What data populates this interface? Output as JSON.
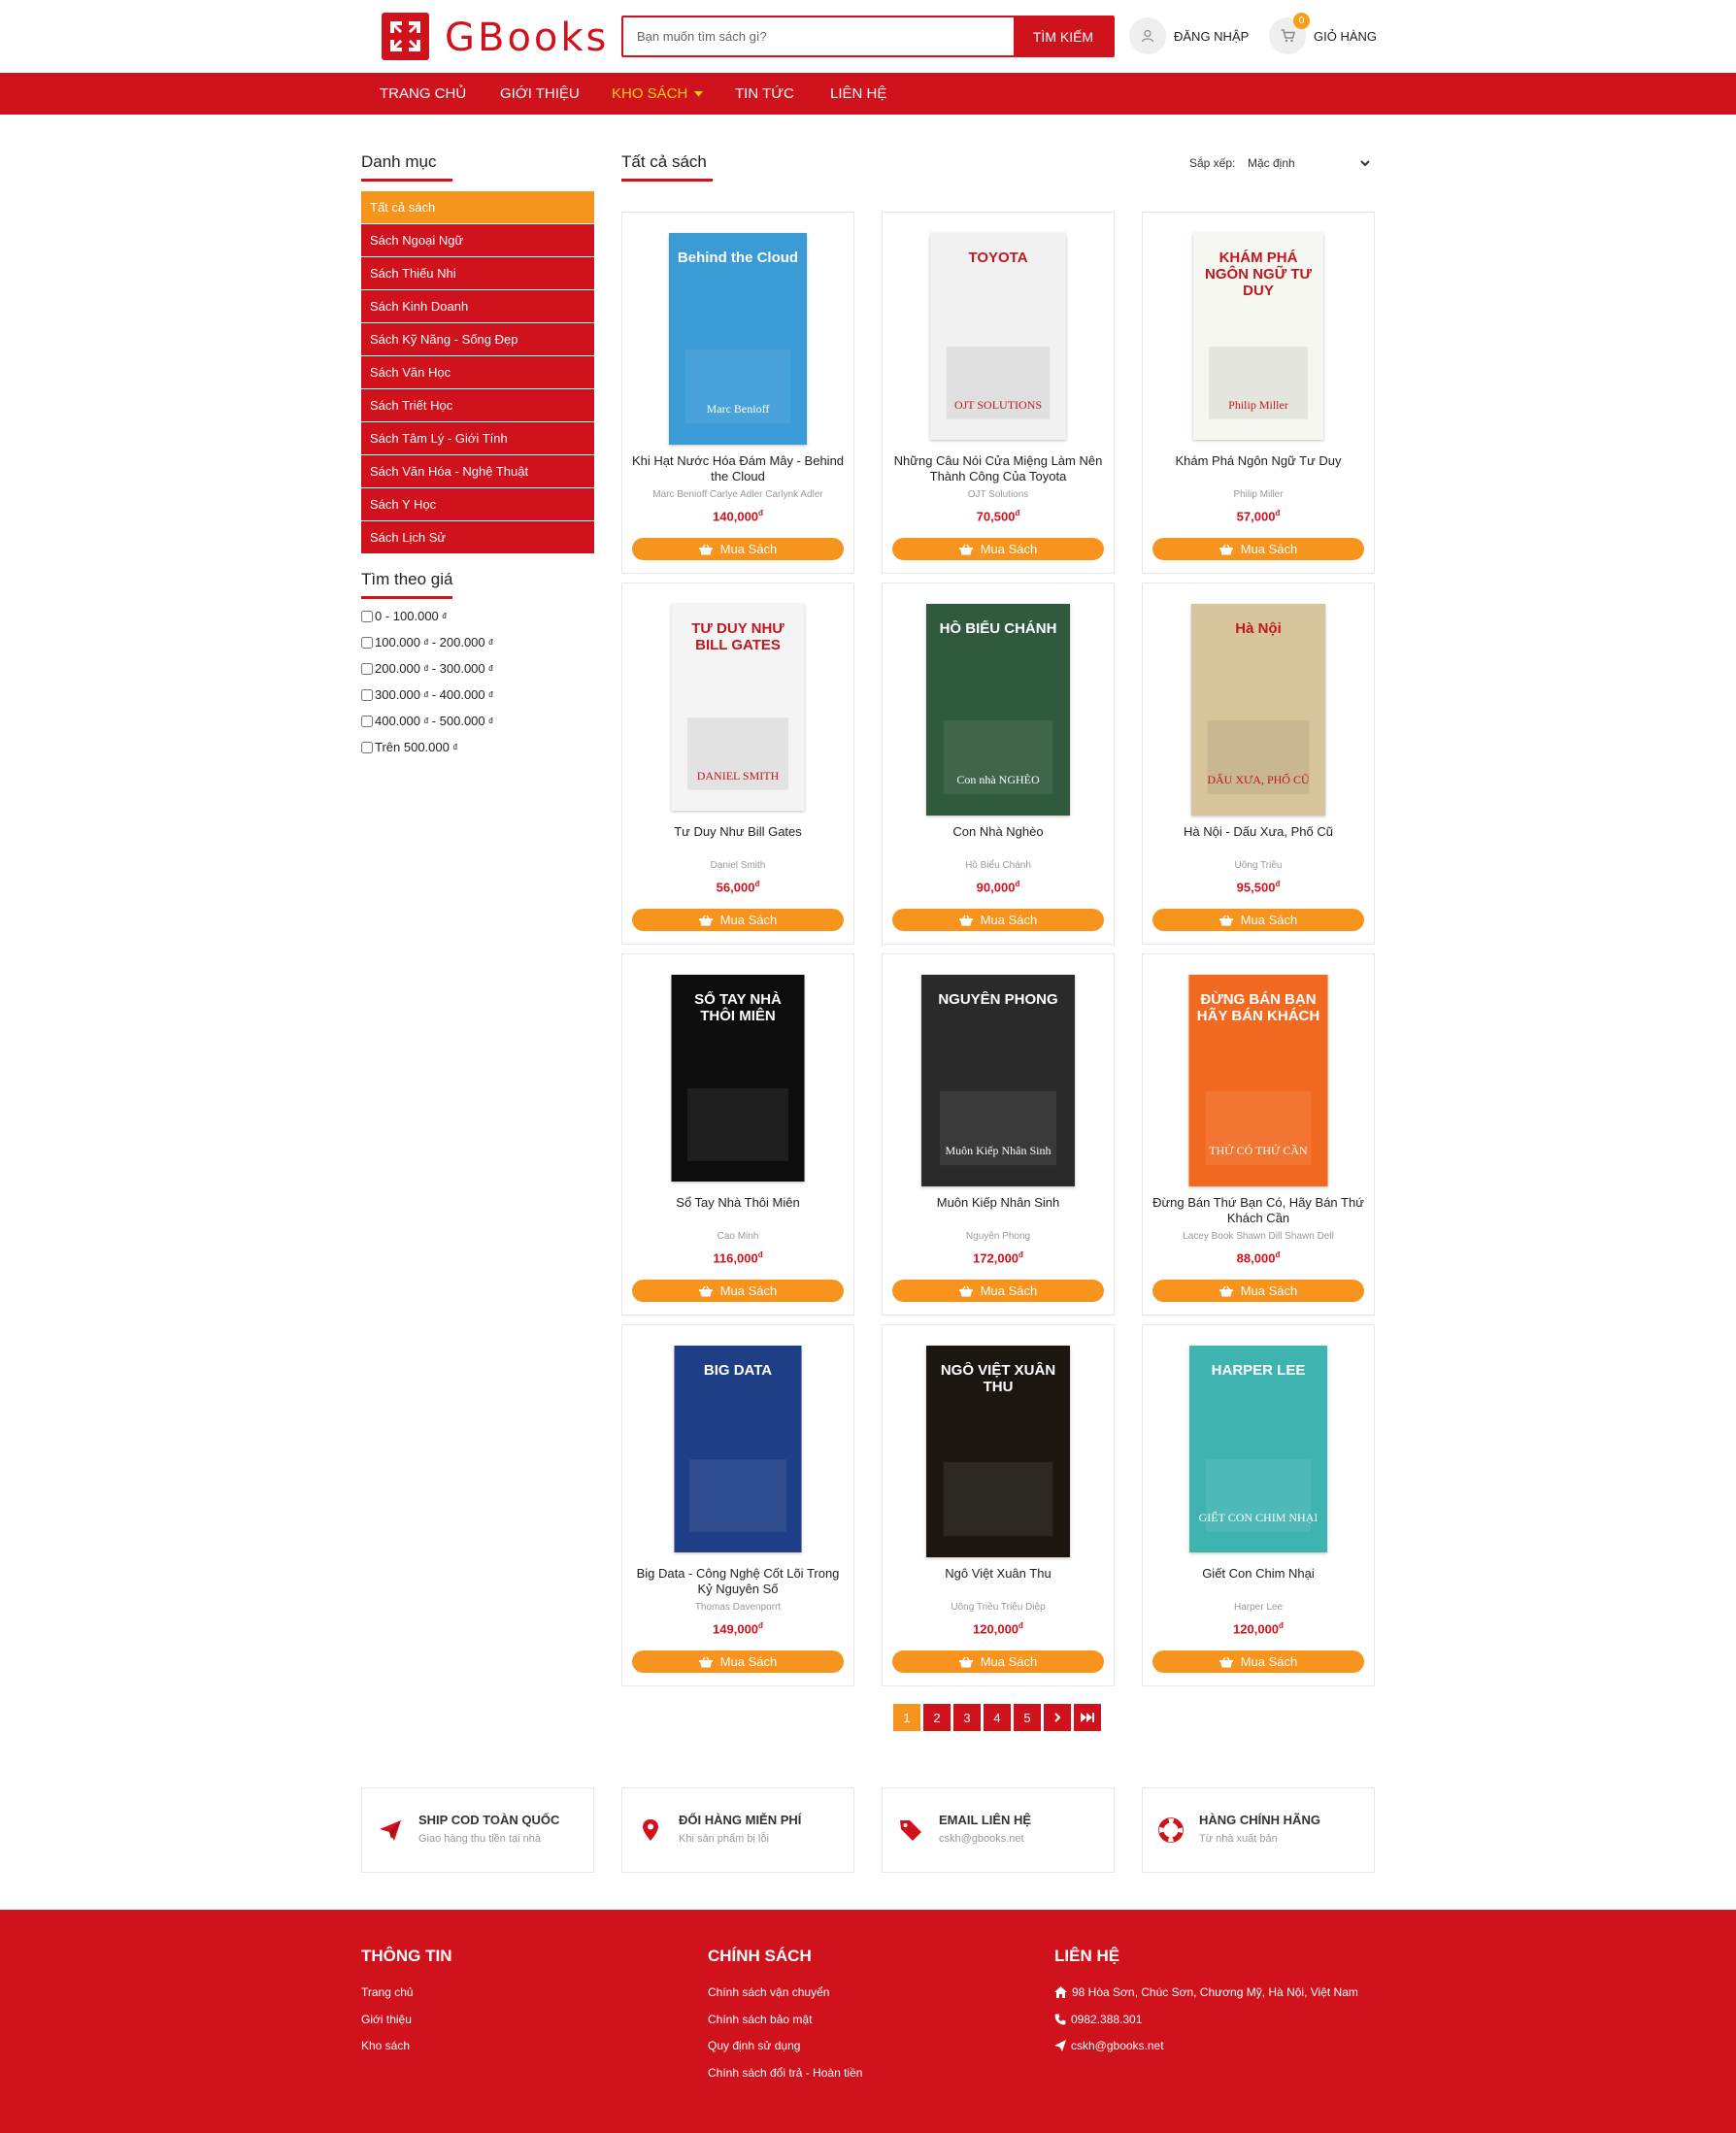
{
  "header": {
    "logo_text": "GBooks",
    "search_placeholder": "Bạn muốn tìm sách gì?",
    "search_button": "TÌM KIẾM",
    "login_label": "ĐĂNG NHẬP",
    "cart_label": "GIỎ HÀNG",
    "cart_count": "0"
  },
  "nav": {
    "items": [
      "TRANG CHỦ",
      "GIỚI THIỆU",
      "KHO SÁCH",
      "TIN TỨC",
      "LIÊN HỆ"
    ],
    "active": "KHO SÁCH"
  },
  "sidebar": {
    "title": "Danh mục",
    "categories": [
      "Tất cả sách",
      "Sách Ngoại Ngữ",
      "Sách Thiếu Nhi",
      "Sách Kinh Doanh",
      "Sách Kỹ Năng - Sống Đẹp",
      "Sách Văn Học",
      "Sách Triết Học",
      "Sách Tâm Lý - Giới Tính",
      "Sách Văn Hóa - Nghệ Thuật",
      "Sách Y Học",
      "Sách Lịch Sử"
    ],
    "price_title": "Tìm theo giá",
    "currency": "đ",
    "price_ranges": [
      {
        "a": "0",
        "b": "100.000"
      },
      {
        "a": "100.000",
        "b": "200.000"
      },
      {
        "a": "200.000",
        "b": "300.000"
      },
      {
        "a": "300.000",
        "b": "400.000"
      },
      {
        "a": "400.000",
        "b": "500.000"
      }
    ],
    "price_over": "Trên 500.000"
  },
  "main": {
    "title": "Tất cả sách",
    "sort_label": "Sắp xếp:",
    "sort_value": "Mặc định",
    "buy_label": "Mua Sách",
    "products": [
      {
        "title": "Khi Hạt Nước Hóa Đám Mây - Behind the Cloud",
        "author": "Marc Benioff Carlye Adler Carlynk Adler",
        "price": "140,000",
        "cover_text": "Behind the Cloud",
        "cover_sub": "Marc Benioff",
        "cover_color": "#3a9bd6"
      },
      {
        "title": "Những Câu Nói Cửa Miệng Làm Nên Thành Công Của Toyota",
        "author": "OJT Solutions",
        "price": "70,500",
        "cover_text": "TOYOTA",
        "cover_sub": "OJT SOLUTIONS",
        "cover_color": "#f1f1f1"
      },
      {
        "title": "Khám Phá Ngôn Ngữ Tư Duy",
        "author": "Philip Miller",
        "price": "57,000",
        "cover_text": "KHÁM PHÁ NGÔN NGỮ TƯ DUY",
        "cover_sub": "Philip Miller",
        "cover_color": "#f7f7f2"
      },
      {
        "title": "Tư Duy Như Bill Gates",
        "author": "Daniel Smith",
        "price": "56,000",
        "cover_text": "TƯ DUY NHƯ BILL GATES",
        "cover_sub": "DANIEL SMITH",
        "cover_color": "#f4f4f4"
      },
      {
        "title": "Con Nhà Nghèo",
        "author": "Hồ Biểu Chánh",
        "price": "90,000",
        "cover_text": "HỒ BIỂU CHÁNH",
        "cover_sub": "Con nhà NGHÈO",
        "cover_color": "#2f5a3c"
      },
      {
        "title": "Hà Nội - Dấu Xưa, Phố Cũ",
        "author": "Uông Triều",
        "price": "95,500",
        "cover_text": "Hà Nội",
        "cover_sub": "DẤU XƯA, PHỐ CŨ",
        "cover_color": "#d8c59c"
      },
      {
        "title": "Sổ Tay Nhà Thôi Miên",
        "author": "Cao Minh",
        "price": "116,000",
        "cover_text": "SỔ TAY NHÀ THÔI MIÊN",
        "cover_sub": "",
        "cover_color": "#0d0d0d"
      },
      {
        "title": "Muôn Kiếp Nhân Sinh",
        "author": "Nguyên Phong",
        "price": "172,000",
        "cover_text": "NGUYÊN PHONG",
        "cover_sub": "Muôn Kiếp Nhân Sinh",
        "cover_color": "#2a2a2a"
      },
      {
        "title": "Đừng Bán Thứ Bạn Có, Hãy Bán Thứ Khách Cần",
        "author": "Lacey Book Shawn Dill Shawn Dell",
        "price": "88,000",
        "cover_text": "ĐỪNG BÁN BẠN HÃY BÁN KHÁCH",
        "cover_sub": "THỨ CÓ THỨ CẦN",
        "cover_color": "#f26a21"
      },
      {
        "title": "Big Data - Công Nghệ Cốt Lõi Trong Kỷ Nguyên Số",
        "author": "Thomas Davenporrt",
        "price": "149,000",
        "cover_text": "BIG DATA",
        "cover_sub": "",
        "cover_color": "#1e3e86"
      },
      {
        "title": "Ngô Việt Xuân Thu",
        "author": "Uông Triều Triệu Diệp",
        "price": "120,000",
        "cover_text": "NGÔ VIỆT XUÂN THU",
        "cover_sub": "",
        "cover_color": "#1b1710"
      },
      {
        "title": "Giết Con Chim Nhại",
        "author": "Harper Lee",
        "price": "120,000",
        "cover_text": "HARPER LEE",
        "cover_sub": "GIẾT CON CHIM NHẠI",
        "cover_color": "#3fb3b0"
      }
    ]
  },
  "pagination": {
    "pages": [
      "1",
      "2",
      "3",
      "4",
      "5"
    ],
    "next": "›",
    "last": "⏭",
    "current": "1"
  },
  "features": [
    {
      "title": "SHIP COD TOÀN QUỐC",
      "sub": "Giao hàng thu tiền tại nhà"
    },
    {
      "title": "ĐỔI HÀNG MIỄN PHÍ",
      "sub": "Khi sản phẩm bị lỗi"
    },
    {
      "title": "EMAIL LIÊN HỆ",
      "sub": "cskh@gbooks.net"
    },
    {
      "title": "HÀNG CHÍNH HÃNG",
      "sub": "Từ nhà xuất bản"
    }
  ],
  "footer": {
    "info_title": "THÔNG TIN",
    "info_links": [
      "Trang chủ",
      "Giới thiệu",
      "Kho sách"
    ],
    "policy_title": "CHÍNH SÁCH",
    "policy_links": [
      "Chính sách vận chuyển",
      "Chính sách bảo mật",
      "Quy định sử dụng",
      "Chính sách đổi trả - Hoàn tiền"
    ],
    "contact_title": "LIÊN HỆ",
    "address": "98 Hòa Sơn, Chúc Sơn, Chương Mỹ, Hà Nội, Việt Nam",
    "phone": "0982.388.301",
    "email": "cskh@gbooks.net"
  },
  "colors": {
    "brand_red": "#d0121c",
    "accent_orange": "#f7941d",
    "nav_active": "#ffd400"
  }
}
